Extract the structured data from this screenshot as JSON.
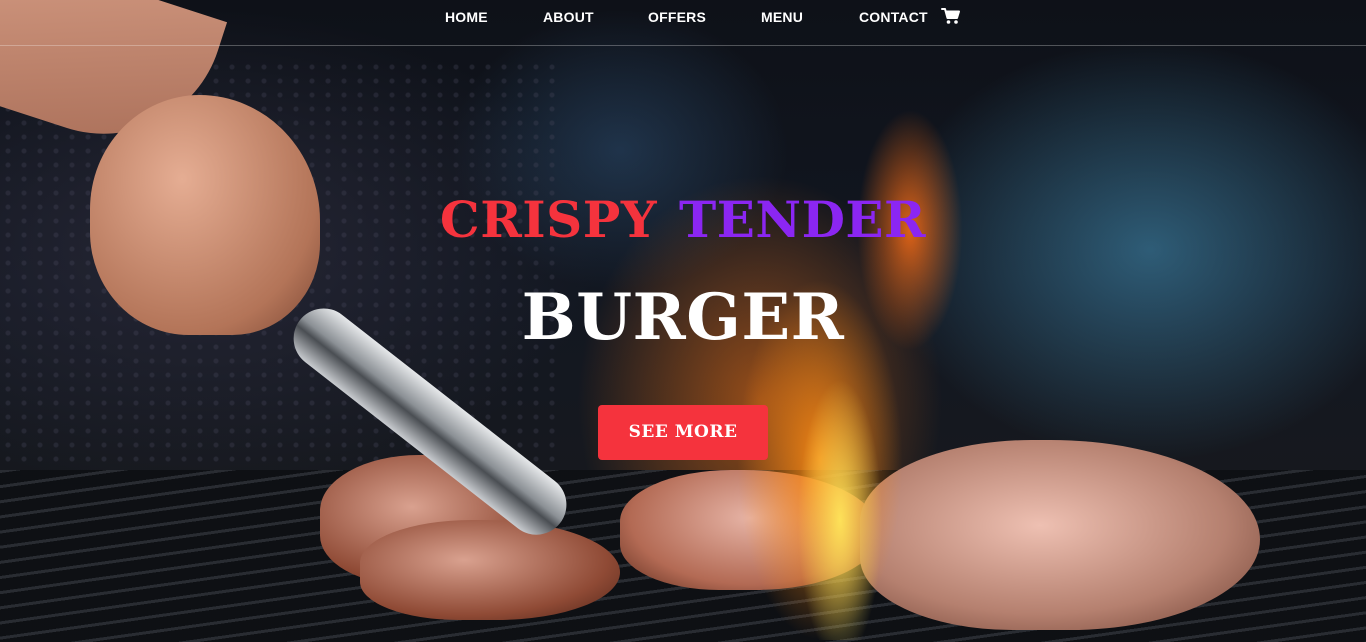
{
  "nav": {
    "items": [
      {
        "label": "HOME"
      },
      {
        "label": "ABOUT"
      },
      {
        "label": "OFFERS"
      },
      {
        "label": "MENU"
      },
      {
        "label": "CONTACT"
      }
    ],
    "cart_icon": "shopping-cart-icon"
  },
  "hero": {
    "title_word1": "CRISPY",
    "title_word2": "TENDER",
    "title_line2": "BURGER",
    "cta_label": "SEE MORE",
    "background_image": "grilling-meat-flames-photo"
  },
  "colors": {
    "accent_red": "#f5333d",
    "accent_purple": "#8b26f2",
    "text_white": "#ffffff"
  }
}
